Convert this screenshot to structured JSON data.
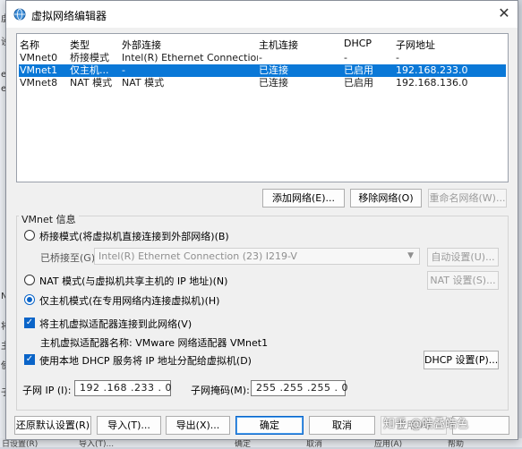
{
  "background": {
    "left_labels": [
      "虚",
      "设",
      "e",
      "e",
      "N",
      "将",
      "主",
      "使",
      "子"
    ],
    "bottom_labels": [
      "日设置(R)",
      "导入(T)...",
      "确定",
      "取消",
      "应用(A)",
      "帮助"
    ]
  },
  "window": {
    "title": "虚拟网络编辑器",
    "close_icon": "close-icon"
  },
  "network_table": {
    "columns": [
      "名称",
      "类型",
      "外部连接",
      "主机连接",
      "DHCP",
      "子网地址"
    ],
    "rows": [
      [
        "VMnet0",
        "桥接模式",
        "Intel(R) Ethernet Connection (...",
        "-",
        "-",
        "-"
      ],
      [
        "VMnet1",
        "仅主机...",
        "-",
        "已连接",
        "已启用",
        "192.168.233.0"
      ],
      [
        "VMnet8",
        "NAT 模式",
        "NAT 模式",
        "已连接",
        "已启用",
        "192.168.136.0"
      ]
    ],
    "selected_row": 1
  },
  "table_buttons": {
    "add": "添加网络(E)...",
    "remove": "移除网络(O)",
    "rename": "重命名网络(W)..."
  },
  "vmnet_info": {
    "title": "VMnet 信息",
    "bridged_label": "桥接模式(将虚拟机直接连接到外部网络)(B)",
    "bridged_to_label": "已桥接至(G):",
    "bridged_to_value": "Intel(R) Ethernet Connection (23) I219-V",
    "auto_settings": "自动设置(U)...",
    "nat_label": "NAT 模式(与虚拟机共享主机的 IP 地址)(N)",
    "nat_settings": "NAT 设置(S)...",
    "hostonly_label": "仅主机模式(在专用网络内连接虚拟机)(H)",
    "connect_adapter_label": "将主机虚拟适配器连接到此网络(V)",
    "adapter_name_label": "主机虚拟适配器名称: VMware 网络适配器 VMnet1",
    "dhcp_label": "使用本地 DHCP 服务将 IP 地址分配给虚拟机(D)",
    "dhcp_settings": "DHCP 设置(P)...",
    "subnet_ip_label": "子网 IP (I):",
    "subnet_ip_value": "192 .168 .233 . 0",
    "subnet_mask_label": "子网掩码(M):",
    "subnet_mask_value": "255 .255 .255 . 0"
  },
  "footer_buttons": {
    "restore": "还原默认设置(R)",
    "import": "导入(T)...",
    "export": "导出(X)...",
    "ok": "确定",
    "cancel": "取消",
    "apply": "应用(A)"
  },
  "watermark": "知乎 @皓叠皓色",
  "colors": {
    "selection": "#0a78d7",
    "accent": "#0a64c8"
  }
}
